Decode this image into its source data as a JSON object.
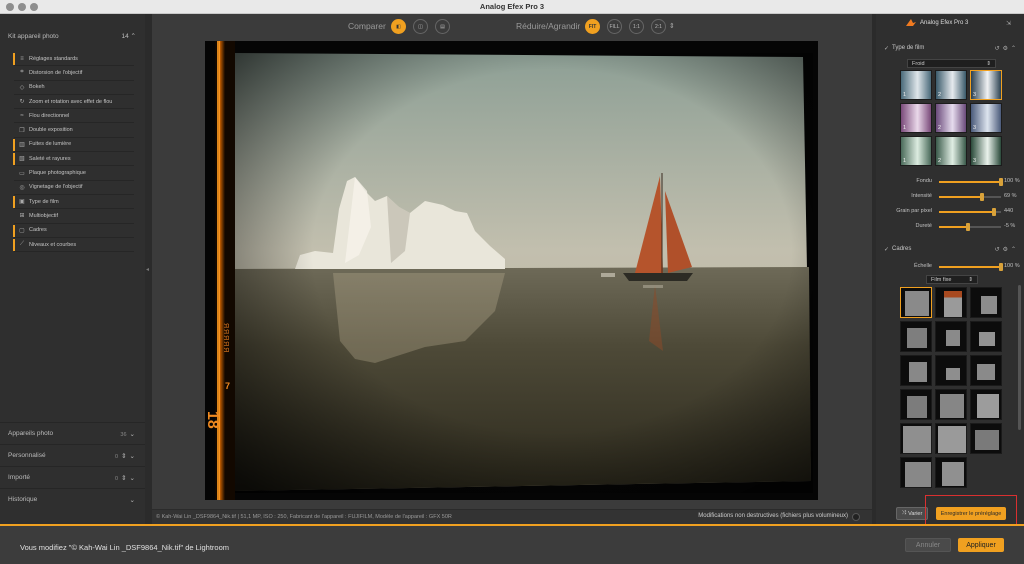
{
  "window": {
    "title": "Analog Efex Pro 3"
  },
  "left_panel": {
    "header": {
      "title": "Kit appareil photo",
      "count": "14"
    },
    "tools": [
      {
        "label": "Réglages standards",
        "icon": "≡",
        "marked": true
      },
      {
        "label": "Distorsion de l'objectif",
        "icon": "⌗",
        "marked": false
      },
      {
        "label": "Bokeh",
        "icon": "◇",
        "marked": false
      },
      {
        "label": "Zoom et rotation avec effet de flou",
        "icon": "↻",
        "marked": false
      },
      {
        "label": "Flou directionnel",
        "icon": "≈",
        "marked": false
      },
      {
        "label": "Double exposition",
        "icon": "❐",
        "marked": false
      },
      {
        "label": "Fuites de lumière",
        "icon": "▥",
        "marked": true
      },
      {
        "label": "Saleté et rayures",
        "icon": "▧",
        "marked": true
      },
      {
        "label": "Plaque photographique",
        "icon": "▭",
        "marked": false
      },
      {
        "label": "Vignetage de l'objectif",
        "icon": "◎",
        "marked": false
      },
      {
        "label": "Type de film",
        "icon": "▣",
        "marked": true
      },
      {
        "label": "Multiobjectif",
        "icon": "⊞",
        "marked": false
      },
      {
        "label": "Cadres",
        "icon": "▢",
        "marked": true
      },
      {
        "label": "Niveaux et courbes",
        "icon": "⟋",
        "marked": true
      }
    ],
    "sections": [
      {
        "label": "Appareils photo",
        "count": "36"
      },
      {
        "label": "Personnalisé",
        "count": "0"
      },
      {
        "label": "Importé",
        "count": "0"
      },
      {
        "label": "Historique",
        "count": ""
      }
    ]
  },
  "toolbar": {
    "compare_label": "Comparer",
    "zoom_label": "Réduire/Agrandir",
    "zoom_options": [
      "FIT",
      "FILL",
      "1:1",
      "2:1"
    ]
  },
  "photo": {
    "edge_text_top": "18",
    "edge_text_mid": "ЯЯЯЯЯ",
    "edge_text_side": "7",
    "colors": {
      "sky": "#b9b8a8",
      "water": "#3f3a2a",
      "sail": "#b5542c"
    }
  },
  "status": {
    "meta": "© Kah-Wai Lin _DSF9864_Nik.tif  |  51,1 MP, ISO : 250, Fabricant de l'appareil : FUJIFILM, Modèle de l'appareil : GFX 50R",
    "nondestructive": "Modifications non destructives (fichiers plus volumineux)"
  },
  "right_panel": {
    "brand": "Analog Efex Pro 3",
    "film_section": {
      "title": "Type de film",
      "dropdown": "Froid",
      "swatches": [
        "1",
        "2",
        "3",
        "1",
        "2",
        "3",
        "1",
        "2",
        "3"
      ],
      "sliders": [
        {
          "label": "Fondu",
          "value": "100 %",
          "fraction": 1.0
        },
        {
          "label": "Intensité",
          "value": "69 %",
          "fraction": 0.69
        },
        {
          "label": "Grain par pixel",
          "value": "440",
          "fraction": 0.88
        },
        {
          "label": "Dureté",
          "value": "-5 %",
          "fraction": 0.47
        }
      ]
    },
    "frames_section": {
      "title": "Cadres",
      "scale_label": "Échelle",
      "scale_value": "100 %",
      "scale_fraction": 1.0,
      "dropdown": "Film fixe"
    },
    "vary_button": "Varier",
    "save_preview_button": "Enregistrer le préréglage"
  },
  "bottom": {
    "message": "Vous modifiez \"© Kah-Wai Lin _DSF9864_Nik.tif\" de Lightroom",
    "cancel": "Annuler",
    "apply": "Appliquer"
  },
  "accent_color": "#f0a020"
}
